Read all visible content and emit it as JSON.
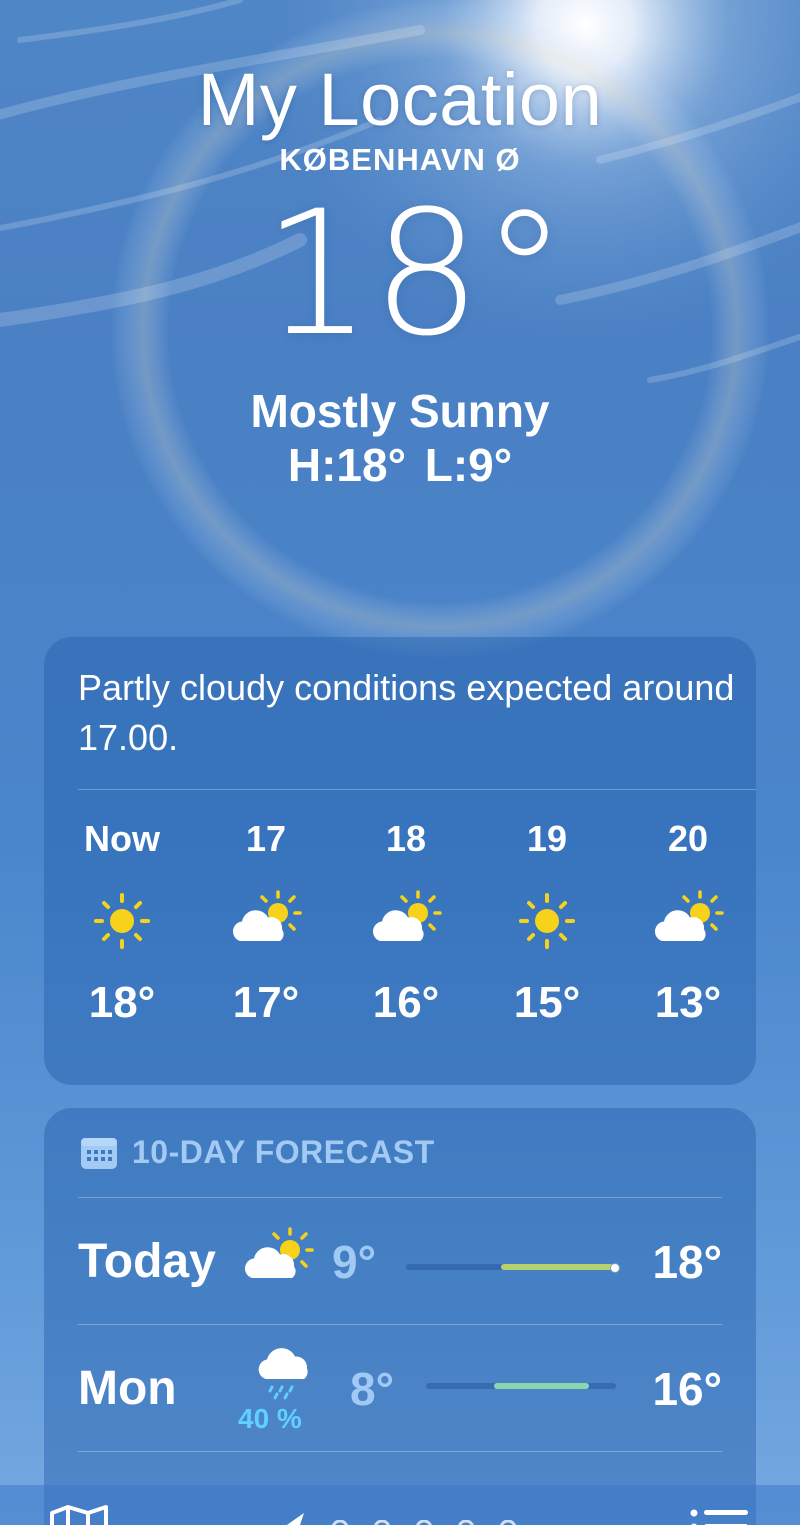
{
  "header": {
    "title": "My Location",
    "subtitle": "KØBENHAVN Ø",
    "temperature": "18°",
    "condition": "Mostly Sunny",
    "high_low": "H:18°  L:9°"
  },
  "hourly": {
    "summary": "Partly cloudy conditions expected around 17.00.",
    "hours": [
      {
        "label": "Now",
        "icon": "sun-icon",
        "temp": "18°"
      },
      {
        "label": "17",
        "icon": "partly-cloudy-icon",
        "temp": "17°"
      },
      {
        "label": "18",
        "icon": "partly-cloudy-icon",
        "temp": "16°"
      },
      {
        "label": "19",
        "icon": "sun-icon",
        "temp": "15°"
      },
      {
        "label": "20",
        "icon": "partly-cloudy-icon",
        "temp": "13°"
      }
    ]
  },
  "daily": {
    "title": "10-DAY FORECAST",
    "icon": "calendar-icon",
    "days": [
      {
        "day": "Today",
        "icon": "partly-cloudy-icon",
        "low": "9°",
        "high": "18°",
        "bar_start": 0.45,
        "bar_end": 1.0,
        "current_marker": 1.0,
        "bar_color": "#b6d26a"
      },
      {
        "day": "Mon",
        "icon": "rain-cloud-icon",
        "precip": "40 %",
        "low": "8°",
        "high": "16°",
        "bar_start": 0.36,
        "bar_end": 0.86,
        "bar_color": "#8ad6b0"
      }
    ]
  },
  "toolbar": {
    "map_icon": "map-icon",
    "location_icon": "location-arrow-icon",
    "list_icon": "list-icon",
    "pages": 5
  },
  "colors": {
    "sun": "#f7d21b",
    "precip": "#5fd0ff",
    "card": "#2f6fb8"
  }
}
